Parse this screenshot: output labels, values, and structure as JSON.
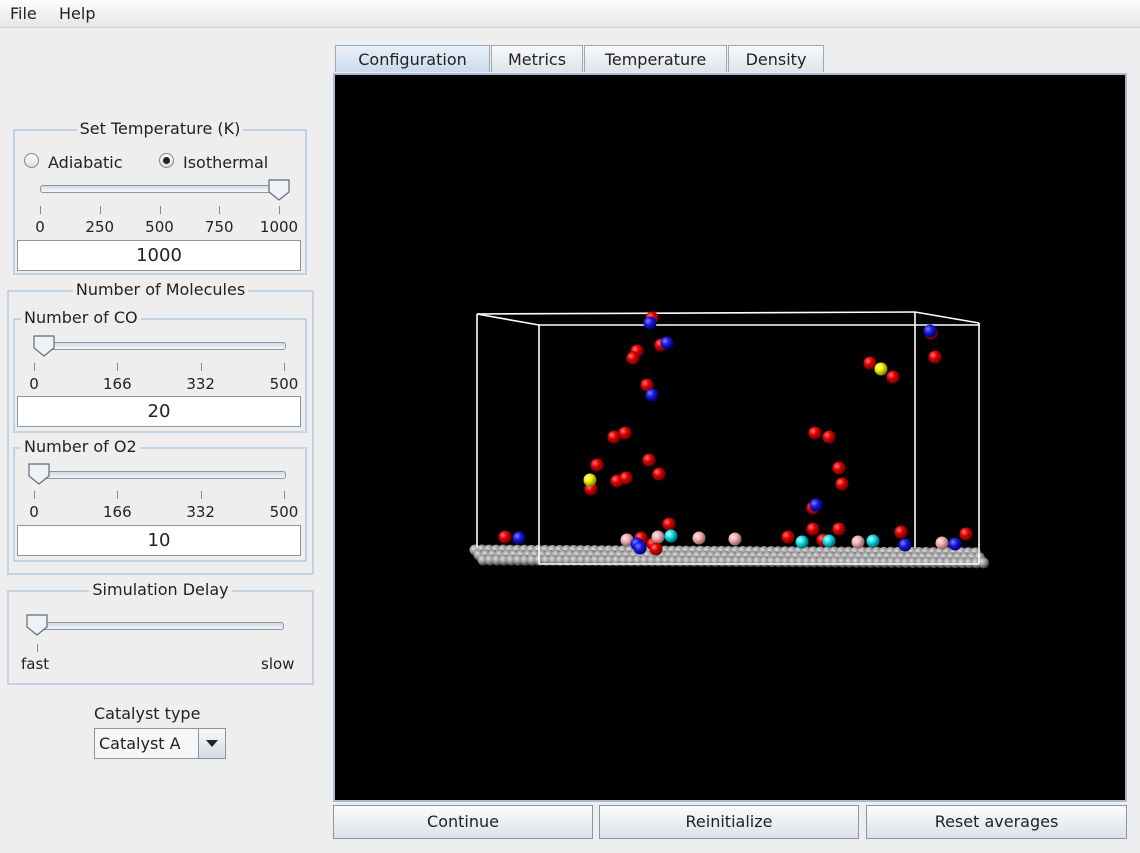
{
  "menu": {
    "file": "File",
    "help": "Help"
  },
  "temperature": {
    "title": "Set Temperature (K)",
    "modes": [
      {
        "label": "Adiabatic",
        "selected": false
      },
      {
        "label": "Isothermal",
        "selected": true
      }
    ],
    "ticks": [
      "0",
      "250",
      "500",
      "750",
      "1000"
    ],
    "min": 0,
    "max": 1000,
    "value": "1000"
  },
  "molecules": {
    "title": "Number of Molecules",
    "co": {
      "title": "Number of CO",
      "ticks": [
        "0",
        "166",
        "332",
        "500"
      ],
      "min": 0,
      "max": 500,
      "value": "20"
    },
    "o2": {
      "title": "Number of O2",
      "ticks": [
        "0",
        "166",
        "332",
        "500"
      ],
      "min": 0,
      "max": 500,
      "value": "10"
    }
  },
  "delay": {
    "title": "Simulation Delay",
    "min_label": "fast",
    "max_label": "slow",
    "level": 0
  },
  "catalyst": {
    "label": "Catalyst type",
    "selected": "Catalyst A"
  },
  "tabs": [
    {
      "label": "Configuration",
      "active": true
    },
    {
      "label": "Metrics",
      "active": false
    },
    {
      "label": "Temperature",
      "active": false
    },
    {
      "label": "Density",
      "active": false
    }
  ],
  "buttons": {
    "continue": "Continue",
    "reinitialize": "Reinitialize",
    "reset": "Reset averages"
  },
  "colors": {
    "oxygen": "#e00000",
    "carbon": "#1a1ae0",
    "sulfur": "#ffff10",
    "cyan": "#10e0e8",
    "pink": "#f0b0b0",
    "surface": "#9a9a9a",
    "box": "#ffffff",
    "group_border": "#c4d3e3"
  }
}
